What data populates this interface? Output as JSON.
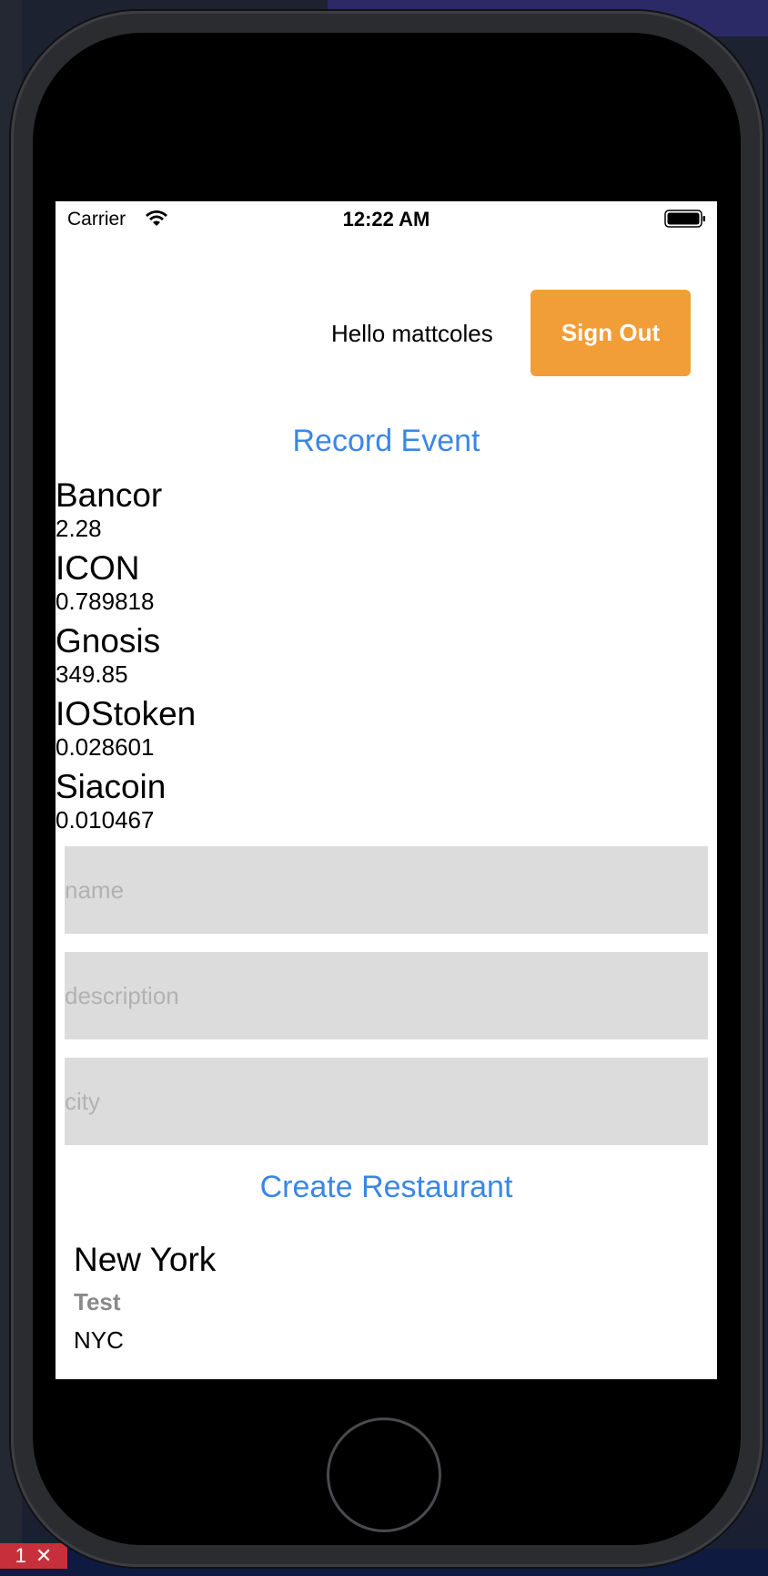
{
  "status_bar": {
    "carrier": "Carrier",
    "time": "12:22 AM"
  },
  "header": {
    "greeting": "Hello mattcoles",
    "sign_out_label": "Sign Out"
  },
  "record_event_label": "Record Event",
  "coins": [
    {
      "name": "Bancor",
      "price": "2.28"
    },
    {
      "name": "ICON",
      "price": "0.789818"
    },
    {
      "name": "Gnosis",
      "price": "349.85"
    },
    {
      "name": "IOStoken",
      "price": "0.028601"
    },
    {
      "name": "Siacoin",
      "price": "0.010467"
    }
  ],
  "form": {
    "name_placeholder": "name",
    "description_placeholder": "description",
    "city_placeholder": "city",
    "create_label": "Create Restaurant"
  },
  "restaurants": [
    {
      "name": "New York",
      "description": "Test",
      "city": "NYC"
    }
  ],
  "error_badge": {
    "count": "1"
  },
  "colors": {
    "accent_blue": "#3a86e8",
    "sign_out_orange": "#f19e38",
    "field_gray": "#dcdcdc"
  }
}
